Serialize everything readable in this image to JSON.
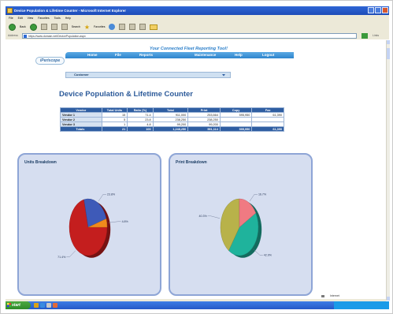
{
  "window": {
    "title": "Device Population & Lifetime Counter - Microsoft Internet Explorer"
  },
  "menubar": [
    "File",
    "Edit",
    "View",
    "Favorites",
    "Tools",
    "Help"
  ],
  "toolbar": {
    "back_label": "Back",
    "search_label": "Search",
    "favorites_label": "Favorites"
  },
  "address": {
    "label": "Address",
    "url": "https://www.domain.net/DevicePopulation.aspx",
    "links_label": "Links"
  },
  "header": {
    "tagline": "Your Connected Fleet Reporting Tool!",
    "logo_text": "iPeriscope",
    "nav": [
      "Home",
      "File",
      "Reports",
      "Maintenance",
      "Help",
      "Logout"
    ],
    "customer_label": "Customer"
  },
  "main": {
    "title": "Device Population & Lifetime Counter",
    "table": {
      "headers": [
        "Vendor",
        "Total Units",
        "Ratio (%)",
        "Total",
        "Print",
        "Copy",
        "Fax"
      ],
      "rows": [
        [
          "Vendor 1",
          "15",
          "71.4",
          "911,000",
          "253,664",
          "595,950",
          "61,390"
        ],
        [
          "Vendor 2",
          "5",
          "23.8",
          "238,250",
          "238,250",
          "",
          ""
        ],
        [
          "Vendor 3",
          "1",
          "4.8",
          "99,200",
          "99,200",
          "",
          ""
        ]
      ],
      "totals": [
        "Totals",
        "21",
        "100",
        "1,248,250",
        "591,114",
        "595,950",
        "61,390"
      ]
    }
  },
  "chart_data": [
    {
      "type": "pie",
      "title": "Units Breakdown",
      "categories": [
        "Vendor 1",
        "Vendor 2",
        "Vendor 3"
      ],
      "values": [
        71.4,
        23.8,
        4.8
      ],
      "colors": [
        "#c41e1e",
        "#3e5ab8",
        "#f08a1c"
      ],
      "data_labels": [
        "71.4%",
        "23.8%",
        "4.8%"
      ]
    },
    {
      "type": "pie",
      "title": "Print Breakdown",
      "categories": [
        "Vendor 1",
        "Vendor 2",
        "Vendor 3"
      ],
      "values": [
        42.9,
        40.3,
        16.7
      ],
      "colors": [
        "#1fb39c",
        "#b8b24a",
        "#f07a82"
      ],
      "data_labels": [
        "42.9%",
        "40.3%",
        "16.7%"
      ]
    }
  ],
  "taskbar": {
    "start_label": "start",
    "tray_text": "Internet"
  }
}
